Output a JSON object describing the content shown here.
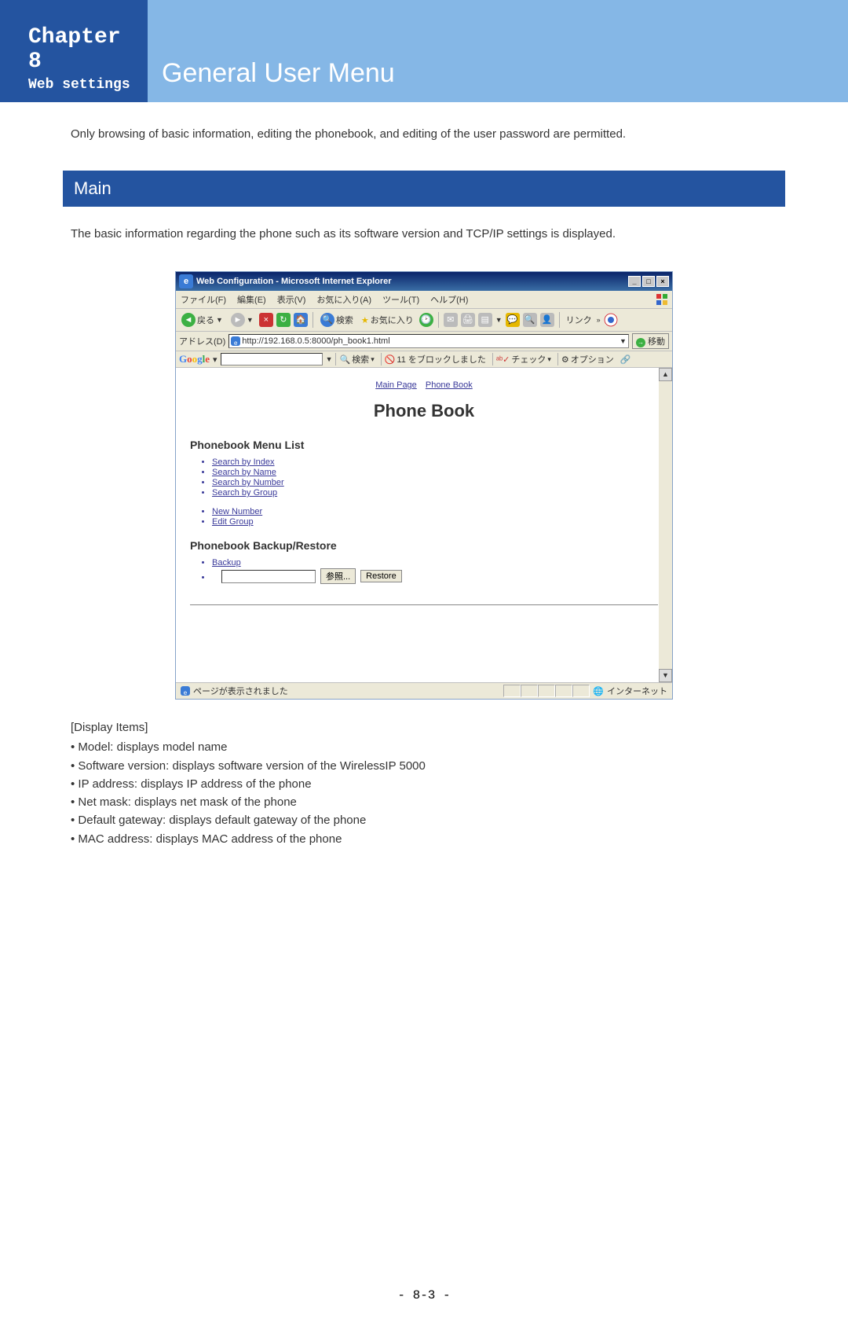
{
  "header": {
    "chapter": "Chapter 8",
    "subtitle": "Web settings",
    "page_title": "General User Menu"
  },
  "intro": "Only browsing of basic information, editing the phonebook, and editing of the user password are permitted.",
  "section": {
    "title": "Main",
    "desc": "The basic information regarding the phone such as its software version and TCP/IP settings is displayed."
  },
  "ie": {
    "window_title": "Web Configuration - Microsoft Internet Explorer",
    "menus": [
      "ファイル(F)",
      "編集(E)",
      "表示(V)",
      "お気に入り(A)",
      "ツール(T)",
      "ヘルプ(H)"
    ],
    "toolbar": {
      "back": "戻る",
      "search": "検索",
      "favorites": "お気に入り",
      "links": "リンク"
    },
    "address_label": "アドレス(D)",
    "address_url": "http://192.168.0.5:8000/ph_book1.html",
    "go_label": "移動",
    "google": {
      "search": "検索",
      "popup": "11 をブロックしました",
      "check": "チェック",
      "options": "オプション"
    },
    "status_left": "ページが表示されました",
    "status_right": "インターネット"
  },
  "pb": {
    "nav": {
      "main": "Main Page",
      "book": "Phone Book"
    },
    "title": "Phone Book",
    "menu_list_header": "Phonebook Menu List",
    "links": {
      "by_index": "Search by Index",
      "by_name": "Search by Name",
      "by_number": "Search by Number",
      "by_group": "Search by Group",
      "new_number": "New Number",
      "edit_group": "Edit Group"
    },
    "backup_header": "Phonebook Backup/Restore",
    "backup": "Backup",
    "browse": "参照...",
    "restore": "Restore"
  },
  "display": {
    "header": "[Display Items]",
    "items": [
      "Model: displays model name",
      "Software version: displays software version of the WirelessIP 5000",
      "IP address: displays IP address of the phone",
      "Net mask: displays net mask of the phone",
      "Default gateway: displays default gateway of the phone",
      "MAC address: displays MAC address of the phone"
    ]
  },
  "footer": "- 8-3 -"
}
